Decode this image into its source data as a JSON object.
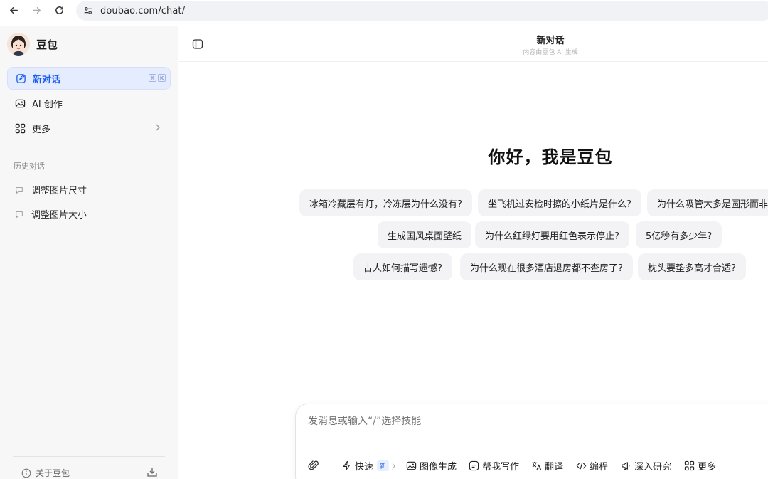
{
  "browser": {
    "url": "doubao.com/chat/"
  },
  "sidebar": {
    "brand": "豆包",
    "menu": [
      {
        "label": "新对话",
        "icon": "edit-icon",
        "active": true
      },
      {
        "label": "AI 创作",
        "icon": "image-icon"
      },
      {
        "label": "更多",
        "icon": "grid-icon"
      }
    ],
    "shortcut_keys": [
      "⌘",
      "K"
    ],
    "history_title": "历史对话",
    "history": [
      "调整图片尺寸",
      "调整图片大小"
    ],
    "about": "关于豆包"
  },
  "header": {
    "title": "新对话",
    "subtitle": "内容由豆包 AI 生成"
  },
  "greeting": "你好，我是豆包",
  "suggestions": [
    "冰箱冷藏层有灯，冷冻层为什么没有?",
    "坐飞机过安检时擦的小纸片是什么?",
    "为什么吸管大多是圆形而非方",
    "生成国风桌面壁纸",
    "为什么红绿灯要用红色表示停止?",
    "5亿秒有多少年?",
    "古人如何描写遗憾?",
    "为什么现在很多酒店退房都不查房了?",
    "枕头要垫多高才合适?"
  ],
  "composer": {
    "placeholder": "发消息或输入“/”选择技能",
    "tools": [
      {
        "label": "快速",
        "icon": "bolt-icon",
        "badge": "新"
      },
      {
        "label": "图像生成",
        "icon": "image-icon"
      },
      {
        "label": "帮我写作",
        "icon": "write-icon"
      },
      {
        "label": "翻译",
        "icon": "translate-icon"
      },
      {
        "label": "编程",
        "icon": "code-icon"
      },
      {
        "label": "深入研究",
        "icon": "megaphone-icon"
      },
      {
        "label": "更多",
        "icon": "grid-icon"
      }
    ]
  },
  "colors": {
    "accent": "#1a5cf0",
    "active_bg": "#e5ecfd",
    "sidebar_bg": "#f7f7f8",
    "chip_bg": "#f3f3f5"
  }
}
